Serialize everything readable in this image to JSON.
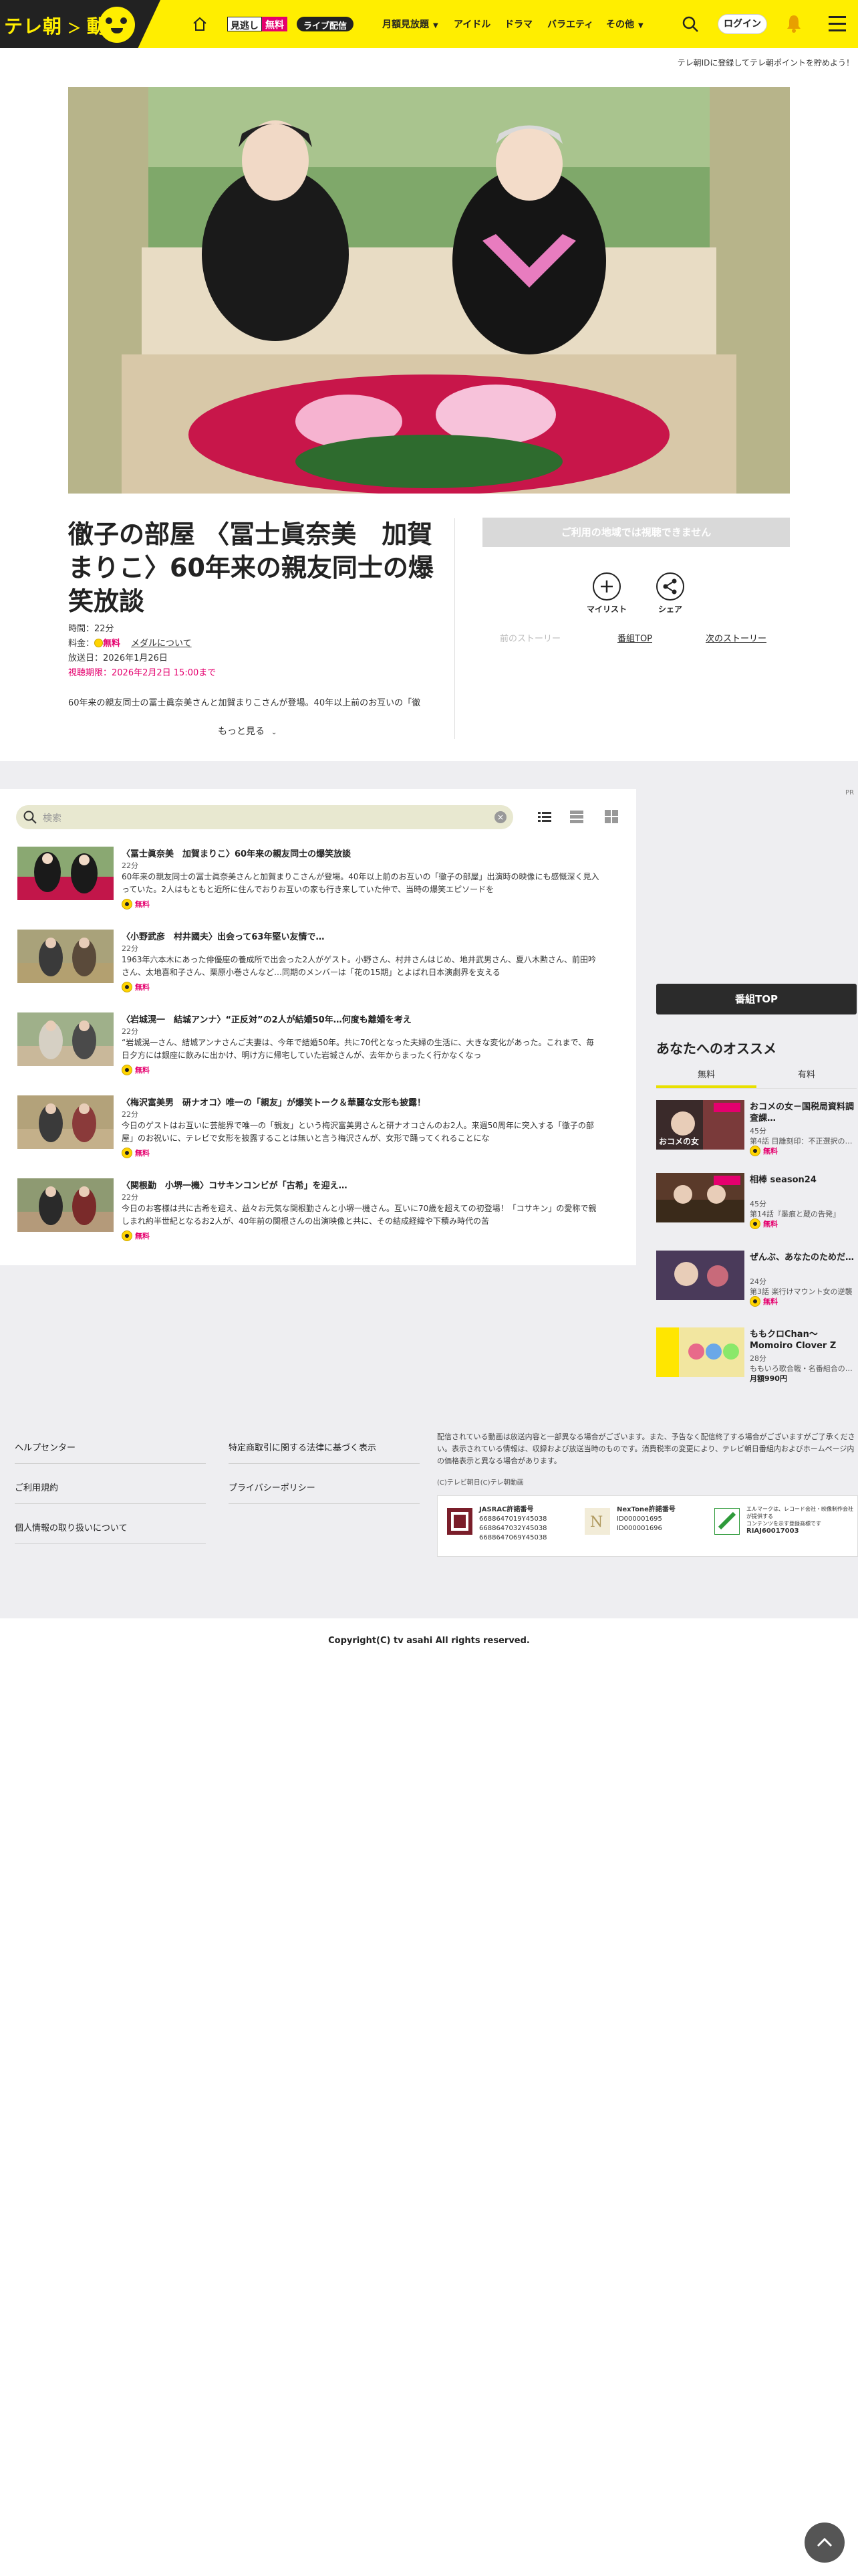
{
  "header": {
    "logo_text": "テレ朝",
    "logo_text2": "動画",
    "mihoudai_a": "見逃し",
    "mihoudai_b": "無料",
    "live_label": "ライブ配信",
    "nav": [
      "月額見放題",
      "アイドル",
      "ドラマ",
      "バラエティ",
      "その他"
    ],
    "login_label": "ログイン"
  },
  "subbar": {
    "text": "テレ朝IDに登録してテレ朝ポイントを貯めよう！"
  },
  "episode": {
    "title": "徹子の部屋 〈冨士眞奈美　加賀まりこ〉60年来の親友同士の爆笑放談",
    "time_label": "時間：",
    "time_value": "22分",
    "price_label": "料金：",
    "price_value": "無料",
    "membership_link": "メダルについて",
    "airdate_label": "放送日：",
    "airdate_value": "2026年1月26日",
    "deadline_label": "視聴期限：",
    "deadline_value": "2026年2月2日 15:00まで",
    "description": "60年来の親友同士の冨士眞奈美さんと加賀まりこさんが登場。40年以上前のお互いの「徹",
    "more_label": "もっと見る"
  },
  "actions": {
    "watch_disabled": "ご利用の地域では視聴できません",
    "mylist_label": "マイリスト",
    "share_label": "シェア",
    "prev_story": "前のストーリー",
    "program_top": "番組TOP",
    "next_story": "次のストーリー"
  },
  "list": {
    "pr_label": "PR",
    "search_placeholder": "検索",
    "items": [
      {
        "title": "〈冨士眞奈美　加賀まりこ〉60年来の親友同士の爆笑放談",
        "duration": "22分",
        "description": "60年来の親友同士の冨士眞奈美さんと加賀まりこさんが登場。40年以上前のお互いの「徹子の部屋」出演時の映像にも感慨深く見入っていた。2人はもともと近所に住んでおりお互いの家も行き来していた仲で、当時の爆笑エピソードを",
        "free": "無料"
      },
      {
        "title": "〈小野武彦　村井國夫〉出会って63年堅い友情で…",
        "duration": "22分",
        "description": "1963年六本木にあった俳優座の養成所で出会った2人がゲスト。小野さん、村井さんはじめ、地井武男さん、夏八木勲さん、前田吟さん、太地喜和子さん、栗原小巻さんなど…同期のメンバーは「花の15期」とよばれ日本演劇界を支える",
        "free": "無料"
      },
      {
        "title": "〈岩城滉一　結城アンナ〉“正反対”の2人が結婚50年…何度も離婚を考え",
        "duration": "22分",
        "description": "“岩城滉一さん、結城アンナさんご夫妻は、今年で結婚50年。共に70代となった夫婦の生活に、大きな変化があった。これまで、毎日夕方には銀座に飲みに出かけ、明け方に帰宅していた岩城さんが、去年からまったく行かなくなっ",
        "free": "無料"
      },
      {
        "title": "〈梅沢富美男　研ナオコ〉唯一の「親友」が爆笑トーク＆華麗な女形も披露！",
        "duration": "22分",
        "description": "今日のゲストはお互いに芸能界で唯一の「親友」という梅沢富美男さんと研ナオコさんのお2人。来週50周年に突入する「徹子の部屋」のお祝いに、テレビで女形を披露することは無いと言う梅沢さんが、女形で踊ってくれることにな",
        "free": "無料"
      },
      {
        "title": "〈関根勤　小堺一機〉コサキンコンビが「古希」を迎え…",
        "duration": "22分",
        "description": "今日のお客様は共に古希を迎え、益々お元気な関根勤さんと小堺一機さん。互いに70歳を超えての初登場！「コサキン」の愛称で親しまれ約半世紀となるお2人が、40年前の関根さんの出演映像と共に、その結成経緯や下積み時代の苦",
        "free": "無料"
      }
    ]
  },
  "sidebar": {
    "program_top": "番組TOP",
    "heading": "あなたへのオススメ",
    "tab_free": "無料",
    "tab_paid": "有料",
    "items": [
      {
        "title": "おコメの女－国税局資料調査課…",
        "duration": "45分",
        "sub": "第4話 目離刻印：不正選択の…",
        "free": "無料",
        "price": ""
      },
      {
        "title": "相棒 season24",
        "duration": "45分",
        "sub": "第14話『墨痕と蔵の告発』",
        "free": "無料",
        "price": ""
      },
      {
        "title": "ぜんぶ、あなたのためだ…",
        "duration": "24分",
        "sub": "第3話 楽行けマウント女の逆襲",
        "free": "無料",
        "price": ""
      },
      {
        "title": "ももクロChan～Momoiro Clover Z Channel～",
        "duration": "28分",
        "sub": "ももいろ歌合戦・名番組合の…",
        "free": "",
        "price": "月額990円"
      }
    ]
  },
  "footer": {
    "links_left": [
      "ヘルプセンター",
      "ご利用規約",
      "個人情報の取り扱いについて"
    ],
    "links_mid": [
      "特定商取引に関する法律に基づく表示",
      "プライバシーポリシー"
    ],
    "note": "配信されている動画は放送内容と一部異なる場合がございます。また、予告なく配信終了する場合がございますがご了承ください。表示されている情報は、収録および放送当時のものです。消費税率の変更により、テレビ朝日番組内およびホームページ内の価格表示と異なる場合があります。",
    "small_copy": "(C)テレビ朝日(C)テレ朝動画",
    "jasrac_title": "JASRAC許諾番号",
    "jasrac_numbers": "6688647019Y45038\n6688647032Y45038\n6688647069Y45038",
    "nextone_title": "NexTone許諾番号",
    "nextone_numbers": "ID000001695\nID000001696",
    "riaj_text": "エルマークは、レコード会社・映像制作会社が提供する\nコンテンツを示す登録商標です",
    "riaj_number": "RIAJ60017003",
    "copyright": "Copyright(C) tv asahi All rights reserved."
  }
}
